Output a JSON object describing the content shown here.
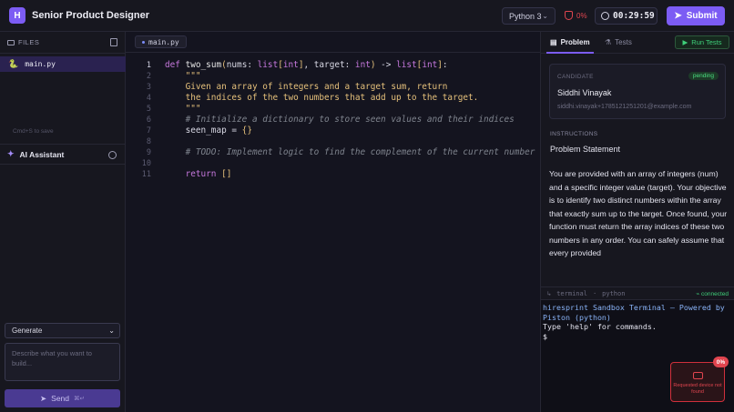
{
  "header": {
    "logo_letter": "H",
    "title": "Senior Product Designer",
    "language": "Python 3",
    "proctor_score": "0%",
    "timer": "00:29:59",
    "submit_label": "Submit"
  },
  "sidebar": {
    "files_label": "FILES",
    "files": [
      {
        "name": "main.py",
        "icon": "python-icon"
      }
    ],
    "save_hint": "Cmd+S to save",
    "ai_title": "AI Assistant",
    "mode_select": "Generate",
    "prompt_placeholder": "Describe what you want to build...",
    "send_label": "Send",
    "send_shortcut": "⌘↵"
  },
  "editor": {
    "tab": "main.py",
    "line_numbers": [
      "1",
      "2",
      "3",
      "4",
      "5",
      "6",
      "7",
      "8",
      "9",
      "10",
      "11"
    ],
    "active_line": 1
  },
  "right_panel": {
    "tabs": {
      "problem": "Problem",
      "tests": "Tests"
    },
    "run_tests_label": "Run Tests",
    "candidate_label": "CANDIDATE",
    "candidate_status": "pending",
    "candidate_name": "Siddhi Vinayak",
    "candidate_email": "siddhi.vinayak+1785121251201@example.com",
    "instructions_label": "INSTRUCTIONS",
    "problem_title": "Problem Statement",
    "description": "You are provided with an array of integers (num) and a specific integer value (target). Your objective is to identify two distinct numbers within the array that exactly sum up to the target. Once found, your function must return the array indices of these two numbers in any order. You can safely assume that every provided"
  },
  "terminal": {
    "label": "terminal",
    "lang": "python",
    "status": "connected",
    "lines": [
      "hiresprint Sandbox Terminal — Powered by",
      "Piston (python)",
      "Type 'help' for commands.",
      "$"
    ]
  },
  "alert": {
    "badge": "0%",
    "message": "Requested device not found"
  },
  "colors": {
    "accent": "#7c5cf4",
    "success": "#3fd07a",
    "danger": "#e0454f"
  }
}
